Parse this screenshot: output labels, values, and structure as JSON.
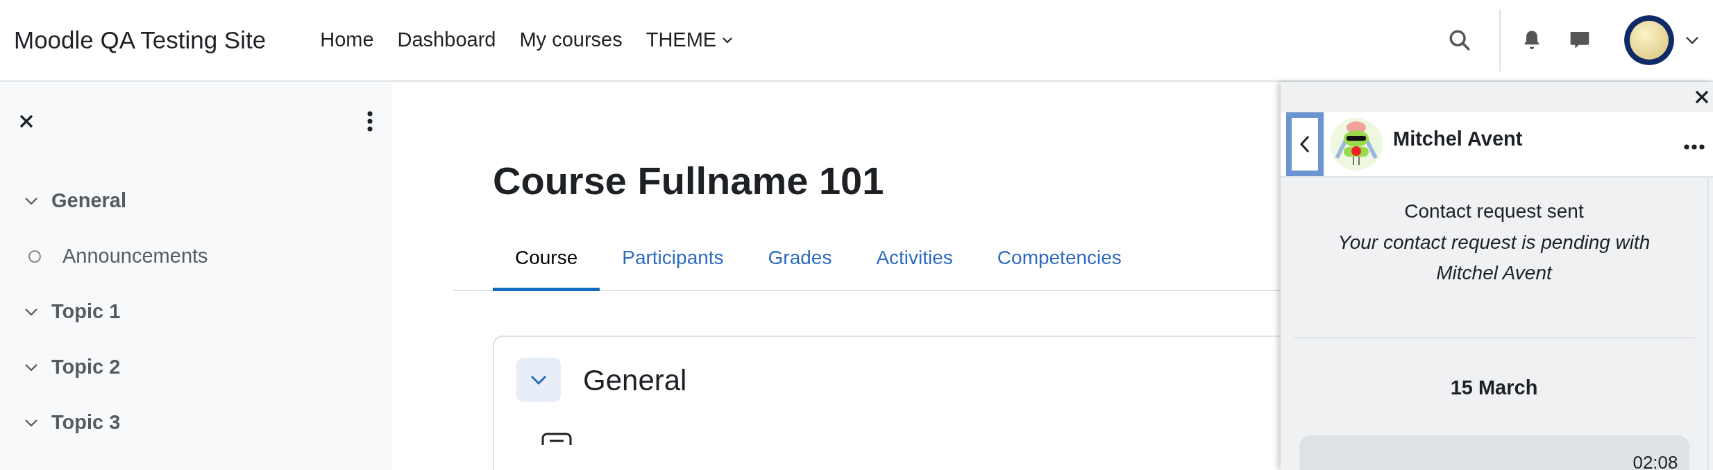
{
  "navbar": {
    "site_name": "Moodle QA Testing Site",
    "links": [
      {
        "label": "Home",
        "kind": "link"
      },
      {
        "label": "Dashboard",
        "kind": "link"
      },
      {
        "label": "My courses",
        "kind": "link"
      },
      {
        "label": "THEME",
        "kind": "dropdown"
      }
    ]
  },
  "course_index": {
    "items": [
      {
        "label": "General",
        "expanded": true,
        "children": [
          {
            "label": "Announcements"
          }
        ]
      },
      {
        "label": "Topic 1",
        "expanded": true
      },
      {
        "label": "Topic 2",
        "expanded": true
      },
      {
        "label": "Topic 3",
        "expanded": true
      }
    ]
  },
  "course": {
    "title": "Course Fullname 101",
    "tabs": [
      {
        "label": "Course",
        "selected": true
      },
      {
        "label": "Participants",
        "selected": false
      },
      {
        "label": "Grades",
        "selected": false
      },
      {
        "label": "Activities",
        "selected": false
      },
      {
        "label": "Competencies",
        "selected": false
      }
    ],
    "section": {
      "title": "General",
      "expanded": true
    }
  },
  "messages_drawer": {
    "contact_name": "Mitchel Avent",
    "status_title": "Contact request sent",
    "status_text": "Your contact request is pending with Mitchel Avent",
    "date": "15 March",
    "messages": [
      {
        "time": "02:08"
      }
    ]
  }
}
